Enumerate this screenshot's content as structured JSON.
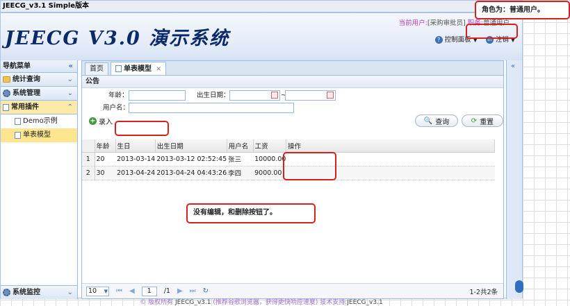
{
  "window": {
    "title": "JEECG_v3.1 Simple版本"
  },
  "header": {
    "logo": "JEECG  V3.0 演示系统",
    "user_label": "当前用户:",
    "user_value": "[采购审批员]",
    "role_label": "职务:",
    "role_value": "普通用户",
    "links": [
      {
        "label": "控制面板"
      },
      {
        "label": "注销"
      }
    ]
  },
  "west": {
    "title": "导航菜单",
    "sections": [
      {
        "label": "统计查询"
      },
      {
        "label": "系统管理"
      },
      {
        "label": "常用插件"
      }
    ],
    "items": [
      {
        "label": "Demo示例"
      },
      {
        "label": "单表模型"
      }
    ],
    "footer": "系统监控"
  },
  "tabs": [
    {
      "label": "首页"
    },
    {
      "label": "单表模型"
    }
  ],
  "panel": {
    "title": "公告"
  },
  "form": {
    "age_label": "年龄：",
    "birth_label": "出生日期：",
    "username_label": "用户名：",
    "range_sep": "~",
    "add_label": "录入",
    "search_label": "查询",
    "reset_label": "重置"
  },
  "table": {
    "headers": [
      "年龄",
      "生日",
      "出生日期",
      "用户名",
      "工资",
      "操作"
    ],
    "rows": [
      {
        "no": "1",
        "age": "20",
        "birthday": "2013-03-14",
        "birthdate": "2013-03-12 02:52:45",
        "name": "张三",
        "salary": "10000.00",
        "ops": ""
      },
      {
        "no": "2",
        "age": "30",
        "birthday": "2013-04-24",
        "birthdate": "2013-04-24 04:43:26",
        "name": "李四",
        "salary": "9000.00",
        "ops": ""
      }
    ]
  },
  "pager": {
    "page_size": "10",
    "page": "1",
    "total_pages": "/1",
    "info": "1-2共2条"
  },
  "footer": {
    "text": "© 版权所有 ",
    "brand": "JEECG_v3.1",
    "note": " (推荐谷歌浏览器，获得更快响应速度) 技术支持:",
    "support": "JEECG_v3.1"
  },
  "annotations": {
    "role_note": "角色为：普通用户。",
    "buttons_note": "没有编辑，和删除按钮了。"
  },
  "colors": {
    "accent": "#99bbe8",
    "annotation": "#d62020",
    "selected": "#fde68f"
  }
}
